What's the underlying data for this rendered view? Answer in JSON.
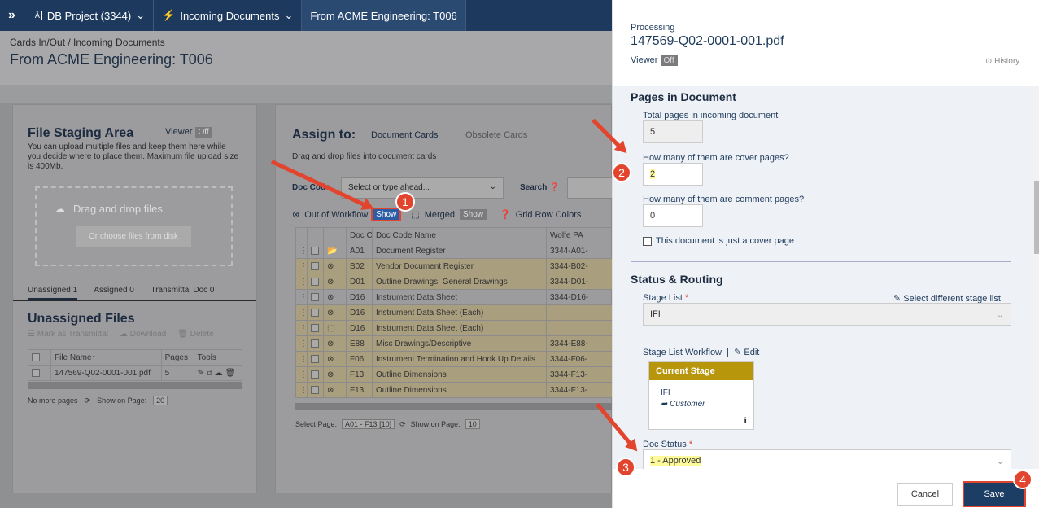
{
  "nav": {
    "project": "DB Project (3344)",
    "incoming": "Incoming Documents",
    "current": "From ACME Engineering: T006"
  },
  "header": {
    "breadcrumb": "Cards In/Out / Incoming Documents",
    "title": "From ACME Engineering: T006"
  },
  "staging": {
    "title": "File Staging Area",
    "viewer_label": "Viewer",
    "viewer_state": "Off",
    "desc": "You can upload multiple files and keep them here while you decide where to place them. Maximum file upload size is 400Mb.",
    "drop_label": "Drag and drop files",
    "choose_label": "Or choose files from disk",
    "tabs": [
      "Unassigned 1",
      "Assigned 0",
      "Transmittal Doc 0"
    ],
    "unassigned_title": "Unassigned Files",
    "mark_label": "Mark as Transmittal",
    "download_label": "Download",
    "delete_label": "Delete",
    "cols": [
      "File Name↑",
      "Pages",
      "Tools"
    ],
    "file": {
      "name": "147569-Q02-0001-001.pdf",
      "pages": "5"
    },
    "footer_left": "No more pages",
    "footer_show": "Show on Page:",
    "footer_count": "20"
  },
  "assign": {
    "title": "Assign to:",
    "tab1": "Document Cards",
    "tab2": "Obsolete Cards",
    "drag_text": "Drag and drop files into document cards",
    "doc_code_label": "Doc Code",
    "select_placeholder": "Select or type ahead...",
    "search_label": "Search",
    "oow_label": "Out of Workflow",
    "show": "Show",
    "merged_label": "Merged",
    "grid_colors": "Grid Row Colors",
    "cols": [
      "Doc Code↑",
      "Doc Code Name",
      "Wolfe PA"
    ],
    "rows": [
      {
        "code": "A01",
        "name": "Document Register",
        "num": "3344-A01-"
      },
      {
        "code": "B02",
        "name": "Vendor Document Register",
        "num": "3344-B02-"
      },
      {
        "code": "D01",
        "name": "Outline Drawings. General Drawings",
        "num": "3344-D01-"
      },
      {
        "code": "D16",
        "name": "Instrument Data Sheet",
        "num": "3344-D16-"
      },
      {
        "code": "D16",
        "name": "Instrument Data Sheet (Each)",
        "num": ""
      },
      {
        "code": "D16",
        "name": "Instrument Data Sheet (Each)",
        "num": ""
      },
      {
        "code": "E88",
        "name": "Misc Drawings/Descriptive",
        "num": "3344-E88-"
      },
      {
        "code": "F06",
        "name": "Instrument Termination and Hook Up Details",
        "num": "3344-F06-"
      },
      {
        "code": "F13",
        "name": "Outline Dimensions",
        "num": "3344-F13-"
      },
      {
        "code": "F13",
        "name": "Outline Dimensions",
        "num": "3344-F13-"
      }
    ],
    "footer_select": "Select Page:",
    "footer_range": "A01 - F13 [10]",
    "footer_show": "Show on Page:",
    "footer_count": "10"
  },
  "right": {
    "processing": "Processing",
    "filename": "147569-Q02-0001-001.pdf",
    "viewer_label": "Viewer",
    "viewer_state": "Off",
    "history": "History",
    "pages_title": "Pages in Document",
    "total_label": "Total pages in incoming document",
    "total_value": "5",
    "cover_label": "How many of them are cover pages?",
    "cover_value": "2",
    "comment_label": "How many of them are comment pages?",
    "comment_value": "0",
    "just_cover": "This document is just a cover page",
    "status_title": "Status & Routing",
    "stage_list_label": "Stage List",
    "select_different": "Select different stage list",
    "stage_list_value": "IFI",
    "workflow_label": "Stage List Workflow",
    "edit": "Edit",
    "current_stage": "Current Stage",
    "stage_code": "IFI",
    "stage_next": "Customer",
    "doc_status_label": "Doc Status",
    "doc_status_value": "1 - Approved",
    "cancel": "Cancel",
    "save": "Save"
  },
  "badges": [
    "1",
    "2",
    "3",
    "4"
  ],
  "colors": {
    "accent": "#e2442d",
    "nav": "#1d3a5e",
    "stage_header": "#b8960c",
    "save": "#1c3d64"
  }
}
